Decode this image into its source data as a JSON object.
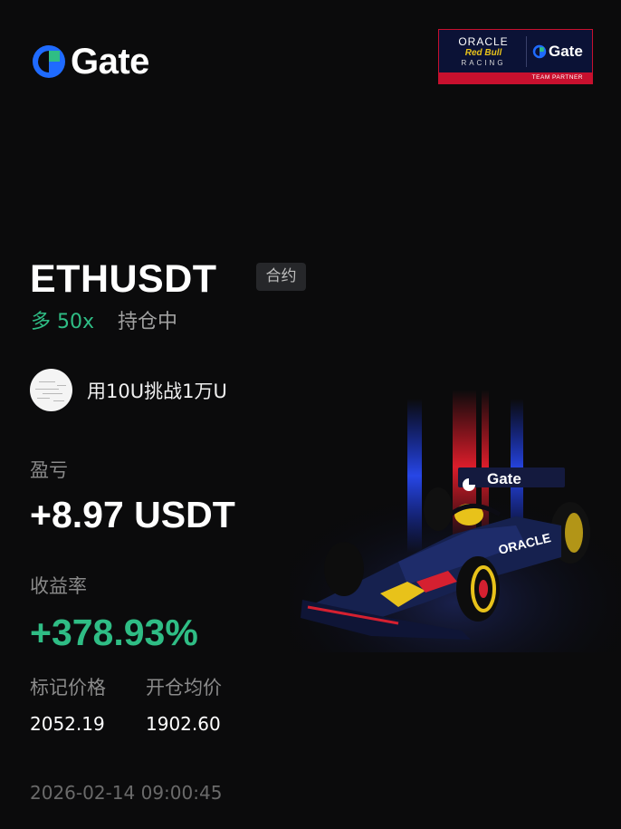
{
  "brand": {
    "name": "Gate",
    "accent": "#1f6bff",
    "accent2": "#2fbd85"
  },
  "partner": {
    "oracle": "ORACLE",
    "redbull": "Red Bull",
    "racing": "RACING",
    "gate": "Gate",
    "tagline": "TEAM PARTNER"
  },
  "position": {
    "symbol": "ETHUSDT",
    "type_badge": "合约",
    "direction": "多 50x",
    "status": "持仓中"
  },
  "user": {
    "challenge": "用10U挑战1万U"
  },
  "pnl": {
    "label": "盈亏",
    "value": "+8.97 USDT"
  },
  "roi": {
    "label": "收益率",
    "value": "+378.93%"
  },
  "prices": {
    "mark_label": "标记价格",
    "mark_value": "2052.19",
    "entry_label": "开仓均价",
    "entry_value": "1902.60"
  },
  "timestamp": "2026-02-14 09:00:45",
  "car": {
    "wing_text": "Gate",
    "sidepod_text": "ORACLE"
  },
  "colors": {
    "profit_green": "#2fbd85",
    "badge_bg": "#26272a",
    "racing_red": "#c8102e",
    "navy": "#0b1236"
  }
}
